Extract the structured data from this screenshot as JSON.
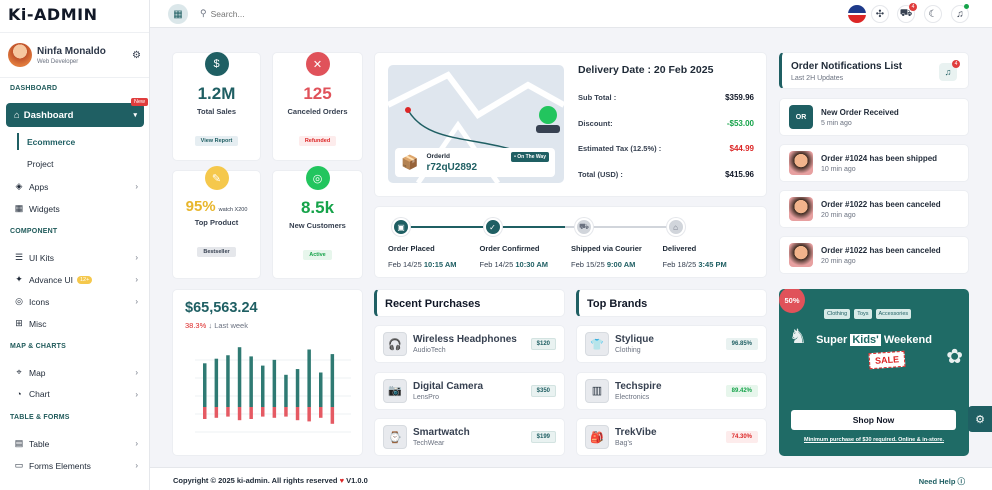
{
  "app": {
    "logo": "Ki-ADMIN"
  },
  "profile": {
    "name": "Ninfa Monaldo",
    "role": "Web Developer"
  },
  "sidebar": {
    "sec_dashboard": "DASHBOARD",
    "dashboard": "Dashboard",
    "new_badge": "New",
    "ecommerce": "Ecommerce",
    "project": "Project",
    "apps": "Apps",
    "widgets": "Widgets",
    "sec_component": "COMPONENT",
    "ui_kits": "UI Kits",
    "advance_ui": "Advance UI",
    "advance_badge": "12+",
    "icons": "Icons",
    "misc": "Misc",
    "sec_map": "MAP & CHARTS",
    "map": "Map",
    "chart": "Chart",
    "sec_table": "TABLE & FORMS",
    "table": "Table",
    "forms": "Forms Elements"
  },
  "topbar": {
    "search_placeholder": "Search...",
    "cart_count": "4"
  },
  "stats": {
    "sales": {
      "value": "1.2M",
      "label": "Total Sales",
      "btn": "View Report"
    },
    "canceled": {
      "value": "125",
      "label": "Canceled Orders",
      "btn": "Refunded"
    },
    "top_product": {
      "value": "95%",
      "sub": "watch X200",
      "label": "Top Product",
      "btn": "Bestseller"
    },
    "customers": {
      "value": "8.5k",
      "label": "New Customers",
      "btn": "Active"
    }
  },
  "delivery": {
    "title": "Delivery Date : 20 Feb 2025",
    "order_label": "OrderId",
    "order_id": "r72qU2892",
    "badge": "On The Way",
    "rows": [
      {
        "label": "Sub Total :",
        "value": "$359.96",
        "color": "#111827"
      },
      {
        "label": "Discount:",
        "value": "-$53.00",
        "color": "#16a34a"
      },
      {
        "label": "Estimated Tax (12.5%) :",
        "value": "$44.99",
        "color": "#dc2626"
      },
      {
        "label": "Total (USD) :",
        "value": "$415.96",
        "color": "#111827"
      }
    ]
  },
  "tracking": [
    {
      "label": "Order Placed",
      "date": "Feb 14/25",
      "time": "10:15 AM"
    },
    {
      "label": "Order Confirmed",
      "date": "Feb 14/25",
      "time": "10:30 AM"
    },
    {
      "label": "Shipped via Courier",
      "date": "Feb 15/25",
      "time": "9:00 AM"
    },
    {
      "label": "Delivered",
      "date": "Feb 18/25",
      "time": "3:45 PM"
    }
  ],
  "revenue": {
    "value": "$65,563.24",
    "change": "38.3%",
    "period": "Last week"
  },
  "chart_data": {
    "type": "bar",
    "series": [
      {
        "values": [
          38,
          42,
          45,
          52,
          44,
          36,
          41,
          28,
          33,
          50,
          30,
          46
        ]
      },
      {
        "values": [
          10,
          9,
          8,
          11,
          10,
          8,
          9,
          8,
          11,
          12,
          9,
          14
        ]
      }
    ]
  },
  "purchases": {
    "title": "Recent Purchases",
    "items": [
      {
        "name": "Wireless Headphones",
        "brand": "AudioTech",
        "price": "$120"
      },
      {
        "name": "Digital Camera",
        "brand": "LensPro",
        "price": "$350"
      },
      {
        "name": "Smartwatch",
        "brand": "TechWear",
        "price": "$199"
      }
    ]
  },
  "brands": {
    "title": "Top Brands",
    "items": [
      {
        "name": "Stylique",
        "cat": "Clothing",
        "pct": "96.85%",
        "color": "#1f5f63",
        "bg": "#e9f2f1"
      },
      {
        "name": "Techspire",
        "cat": "Electronics",
        "pct": "89.42%",
        "color": "#16a34a",
        "bg": "#e7f6ec"
      },
      {
        "name": "TrekVibe",
        "cat": "Bag's",
        "pct": "74.30%",
        "color": "#dc2626",
        "bg": "#fdecec"
      }
    ]
  },
  "notifications": {
    "title": "Order Notifications List",
    "subtitle": "Last 2H Updates",
    "count": "4",
    "items": [
      {
        "text": "New Order Received",
        "time": "5 min ago",
        "avatar": "OR"
      },
      {
        "text": "Order #1024 has been shipped",
        "time": "10 min ago"
      },
      {
        "text": "Order #1022 has been canceled",
        "time": "20 min ago"
      },
      {
        "text": "Order #1022 has been canceled",
        "time": "20 min ago"
      }
    ]
  },
  "promo": {
    "badge": "50%",
    "tags": [
      "Clothing",
      "Toys",
      "Accessories"
    ],
    "title_a": "Super ",
    "title_b": "Kids'",
    "title_c": " Weekend",
    "sale": "SALE",
    "btn": "Shop Now",
    "note": "Minimum purchase of $30 required. Online & in-store."
  },
  "footer": {
    "copyright": "Copyright © 2025 ki-admin. All rights reserved",
    "version": "V1.0.0",
    "help": "Need Help"
  }
}
